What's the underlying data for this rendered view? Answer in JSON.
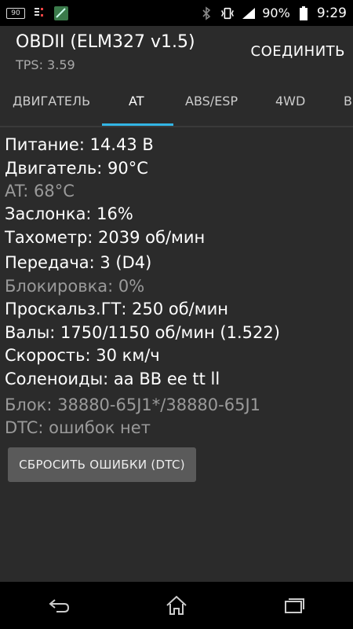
{
  "status_bar": {
    "battery_small_label": "90",
    "battery_percent": "90%",
    "time": "9:29",
    "icons": [
      "notification-battery-icon",
      "sim-icon",
      "app-notification-icon",
      "bluetooth-icon",
      "vibrate-icon",
      "signal-icon",
      "battery-icon"
    ]
  },
  "app": {
    "title": "OBDII (ELM327 v1.5)",
    "subtitle": "TPS: 3.59",
    "connect_label": "СОЕДИНИТЬ"
  },
  "tabs": [
    {
      "label": "ДВИГАТЕЛЬ",
      "active": false
    },
    {
      "label": "AT",
      "active": true
    },
    {
      "label": "ABS/ESP",
      "active": false
    },
    {
      "label": "4WD",
      "active": false
    },
    {
      "label": "B",
      "active": false
    }
  ],
  "readings": {
    "power": "Питание: 14.43 В",
    "engine": "Двигатель: 90°C",
    "at_temp": "AT: 68°C",
    "throttle": "Заслонка: 16%",
    "tachometer": "Тахометр: 2039 об/мин",
    "gear": "Передача: 3 (D4)",
    "lockup": "Блокировка: 0%",
    "slip": "Проскальз.ГТ: 250 об/мин",
    "shafts": "Валы: 1750/1150 об/мин (1.522)",
    "speed": "Скорость: 30 км/ч",
    "solenoids": "Соленоиды: aa BB ee tt ll",
    "block": "Блок: 38880-65J1*/38880-65J1",
    "dtc": "DTC: ошибок нет"
  },
  "actions": {
    "reset_dtc_label": "СБРОСИТЬ ОШИБКИ (DTC)"
  },
  "colors": {
    "accent": "#33b5e5",
    "background": "#2b2b2b",
    "dim_text": "#9a9a9a"
  }
}
